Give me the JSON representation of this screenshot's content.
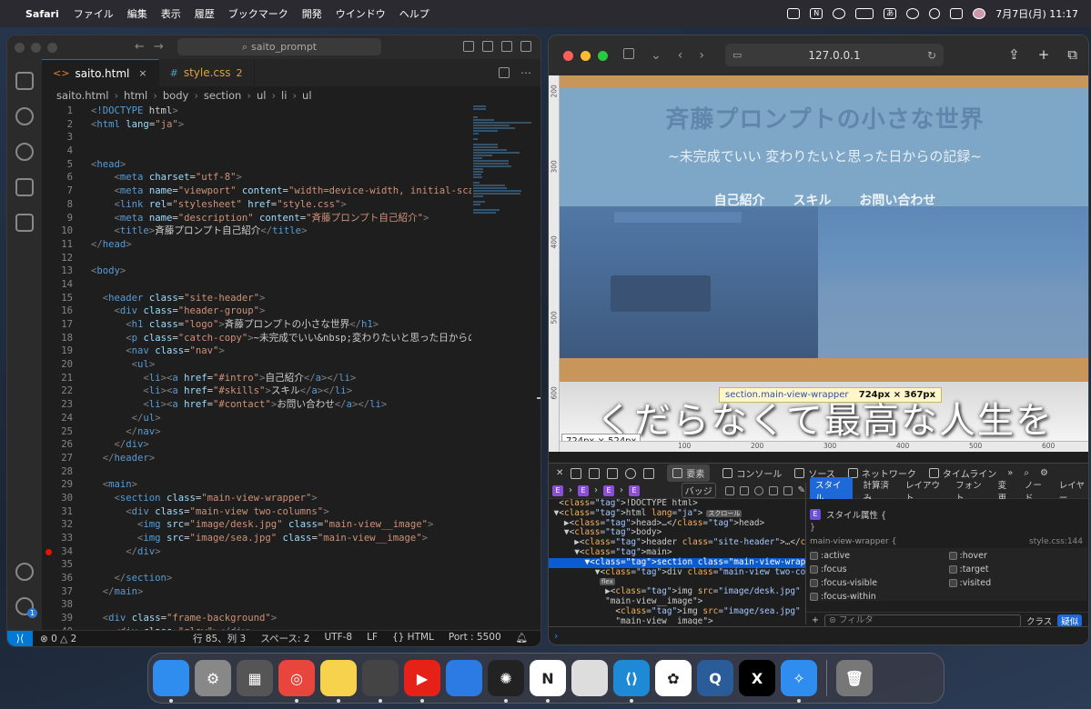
{
  "menubar": {
    "app": "Safari",
    "items": [
      "ファイル",
      "編集",
      "表示",
      "履歴",
      "ブックマーク",
      "開発",
      "ウインドウ",
      "ヘルプ"
    ],
    "ime": "あ",
    "notion_icon": "N",
    "datetime": "7月7日(月)  11:17"
  },
  "vscode": {
    "search": "saito_prompt",
    "tabs": [
      {
        "icon": "<>",
        "label": "saito.html",
        "close": "×"
      },
      {
        "icon": "#",
        "label": "style.css",
        "count": "2"
      }
    ],
    "breadcrumb": [
      "saito.html",
      "html",
      "body",
      "section",
      "ul",
      "li",
      "ul"
    ],
    "lines": [
      {
        "n": "1",
        "code": "<!DOCTYPE html>"
      },
      {
        "n": "2",
        "code": "<html lang=\"ja\">"
      },
      {
        "n": "3",
        "code": ""
      },
      {
        "n": "4",
        "code": ""
      },
      {
        "n": "5",
        "code": "<head>"
      },
      {
        "n": "6",
        "code": "    <meta charset=\"utf-8\">"
      },
      {
        "n": "7",
        "code": "    <meta name=\"viewport\" content=\"width=device-width, initial-scale=1\""
      },
      {
        "n": "8",
        "code": "    <link rel=\"stylesheet\" href=\"style.css\">"
      },
      {
        "n": "9",
        "code": "    <meta name=\"description\" content=\"斉藤プロンプト自己紹介\">"
      },
      {
        "n": "10",
        "code": "    <title>斉藤プロンプト自己紹介</title>"
      },
      {
        "n": "11",
        "code": "</head>"
      },
      {
        "n": "12",
        "code": ""
      },
      {
        "n": "13",
        "code": "<body>"
      },
      {
        "n": "14",
        "code": ""
      },
      {
        "n": "15",
        "code": "  <header class=\"site-header\">"
      },
      {
        "n": "16",
        "code": "    <div class=\"header-group\">"
      },
      {
        "n": "17",
        "code": "      <h1 class=\"logo\">斉藤プロンプトの小さな世界</h1>"
      },
      {
        "n": "18",
        "code": "      <p class=\"catch-copy\">~未完成でいい&nbsp;変わりたいと思った日からの記録~"
      },
      {
        "n": "19",
        "code": "      <nav class=\"nav\">"
      },
      {
        "n": "20",
        "code": "       <ul>"
      },
      {
        "n": "21",
        "code": "         <li><a href=\"#intro\">自己紹介</a></li>"
      },
      {
        "n": "22",
        "code": "         <li><a href=\"#skills\">スキル</a></li>"
      },
      {
        "n": "23",
        "code": "         <li><a href=\"#contact\">お問い合わせ</a></li>"
      },
      {
        "n": "24",
        "code": "       </ul>"
      },
      {
        "n": "25",
        "code": "      </nav>"
      },
      {
        "n": "26",
        "code": "    </div>"
      },
      {
        "n": "27",
        "code": "  </header>"
      },
      {
        "n": "28",
        "code": ""
      },
      {
        "n": "29",
        "code": "  <main>"
      },
      {
        "n": "30",
        "code": "    <section class=\"main-view-wrapper\">"
      },
      {
        "n": "31",
        "code": "      <div class=\"main-view two-columns\">"
      },
      {
        "n": "32",
        "code": "        <img src=\"image/desk.jpg\" class=\"main-view__image\">"
      },
      {
        "n": "33",
        "code": "        <img src=\"image/sea.jpg\" class=\"main-view__image\">"
      },
      {
        "n": "34",
        "code": "      </div>"
      },
      {
        "n": "35",
        "code": ""
      },
      {
        "n": "36",
        "code": "    </section>"
      },
      {
        "n": "37",
        "code": "  </main>"
      },
      {
        "n": "38",
        "code": ""
      },
      {
        "n": "39",
        "code": "  <div class=\"frame-background\">"
      },
      {
        "n": "40",
        "code": "    <div class=\"glow\"></div>"
      }
    ],
    "status": {
      "errors": "⊗ 0 △ 2",
      "position": "行 85、列 3",
      "spaces": "スペース: 2",
      "encoding": "UTF-8",
      "eol": "LF",
      "language": "{} HTML",
      "port": "Port : 5500"
    }
  },
  "safari": {
    "url": "127.0.0.1",
    "site": {
      "h1": "斉藤プロンプトの小さな世界",
      "catch": "~未完成でいい 変わりたいと思った日からの記録~",
      "nav": [
        "自己紹介",
        "スキル",
        "お問い合わせ"
      ],
      "hero": "くだらなくて最高な人生を"
    },
    "ruler_v": [
      "200",
      "300",
      "400",
      "500",
      "600"
    ],
    "ruler_h": [
      "100",
      "200",
      "300",
      "400",
      "500",
      "600",
      "700"
    ],
    "tooltip": {
      "cls": "section.main-view-wrapper",
      "size": "724px × 367px"
    },
    "size_tip": "724px × 524px",
    "devtools": {
      "tabs": [
        "要素",
        "コンソール",
        "ソース",
        "ネットワーク",
        "タイムライン"
      ],
      "badge_label": "バッジ",
      "dom": [
        {
          "html": "  <!DOCTYPE html>"
        },
        {
          "html": " ▼<html lang=\"ja\">",
          "pill": "スクロール"
        },
        {
          "html": "   ▶<head>…</head>"
        },
        {
          "html": "   ▼<body>"
        },
        {
          "html": "     ▶<header class=\"site-header\">…</header>",
          "pill": "flex"
        },
        {
          "html": "     ▼<main>"
        },
        {
          "html": "       ▼<section class=\"main-view-wrapper\"> = $0",
          "sel": true
        },
        {
          "html": "         ▼<div class=\"main-view two-columns\">"
        },
        {
          "html": "",
          "pill": "flex"
        },
        {
          "html": "           ▶<img src=\"image/desk.jpg\" class="
        },
        {
          "html": "           \"main-view__image\">"
        },
        {
          "html": "             <img src=\"image/sea.jpg\" class="
        },
        {
          "html": "             \"main-view__image\">"
        }
      ],
      "style_tabs": [
        "スタイル",
        "計算済み",
        "レイアウト",
        "フォント",
        "変更",
        "ノード",
        "レイヤー"
      ],
      "style_attr": "スタイル属性 {",
      "style_close": "}",
      "rule": "main-view-wrapper {",
      "rule_src": "style.css:144",
      "pseudo": [
        ":active",
        ":hover",
        ":focus",
        ":target",
        ":focus-visible",
        ":visited",
        ":focus-within"
      ],
      "filter_placeholder": "フィルタ",
      "class_btn": "クラス",
      "pseudo_btn": "疑似"
    }
  },
  "dock": [
    {
      "name": "finder",
      "label": "",
      "color": "#2f8df0"
    },
    {
      "name": "system-settings",
      "label": "⚙",
      "color": "#888"
    },
    {
      "name": "launchpad",
      "label": "▦",
      "color": "#555"
    },
    {
      "name": "chrome",
      "label": "◎",
      "color": "#e8453c"
    },
    {
      "name": "notes",
      "label": "",
      "color": "#f7d24c"
    },
    {
      "name": "iphone-mirroring",
      "label": "",
      "color": "#444"
    },
    {
      "name": "youtube",
      "label": "▶",
      "color": "#e62117"
    },
    {
      "name": "toolbox",
      "label": "",
      "color": "#2c7be5"
    },
    {
      "name": "chatgpt",
      "label": "✺",
      "color": "#222"
    },
    {
      "name": "notion",
      "label": "N",
      "color": "#fff"
    },
    {
      "name": "bear",
      "label": "",
      "color": "#ddd"
    },
    {
      "name": "vscode",
      "label": "⟨⟩",
      "color": "#1e8ad6"
    },
    {
      "name": "photos",
      "label": "✿",
      "color": "#fff"
    },
    {
      "name": "quicktime",
      "label": "Q",
      "color": "#2a5c9a"
    },
    {
      "name": "x",
      "label": "X",
      "color": "#000"
    },
    {
      "name": "safari",
      "label": "✧",
      "color": "#2f8df0"
    },
    {
      "name": "trash",
      "label": "🗑",
      "color": "#777"
    }
  ],
  "colors": {
    "accent": "#0078d4",
    "selection": "#0b5bd3",
    "header_bar": "#c8965a"
  }
}
